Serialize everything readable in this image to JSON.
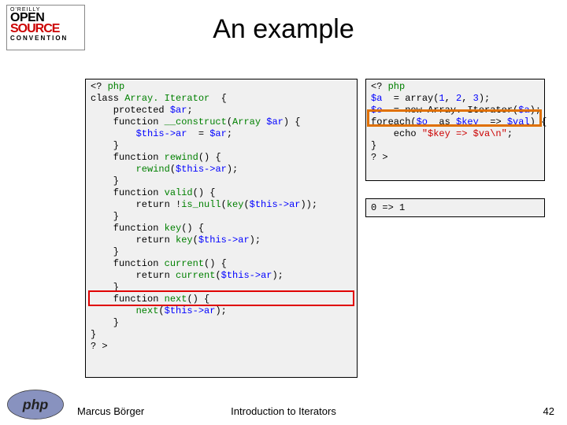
{
  "logo": {
    "oreilly": "O'REILLY",
    "open": "OPEN",
    "source": "SOURCE",
    "convention": "CONVENTION"
  },
  "title": "An example",
  "code_left": {
    "t": [
      {
        "s": [
          "<? ",
          "php"
        ]
      },
      {
        "s": [
          "class ",
          "Array. Iterator ",
          " {"
        ]
      },
      {
        "s": [
          "    protected ",
          "$ar",
          ";"
        ]
      },
      {
        "s": [
          "    function ",
          "__construct",
          "(",
          "Array ",
          "$ar",
          ") {"
        ]
      },
      {
        "s": [
          "        ",
          "$this->ar ",
          " = ",
          "$ar",
          ";"
        ]
      },
      {
        "s": [
          "    }"
        ]
      },
      {
        "s": [
          "    function ",
          "rewind",
          "() {"
        ]
      },
      {
        "s": [
          "        ",
          "rewind",
          "(",
          "$this->ar",
          ");"
        ]
      },
      {
        "s": [
          "    }"
        ]
      },
      {
        "s": [
          "    function ",
          "valid",
          "() {"
        ]
      },
      {
        "s": [
          "        return !",
          "is_null",
          "(",
          "key",
          "(",
          "$this->ar",
          "));"
        ]
      },
      {
        "s": [
          "    }"
        ]
      },
      {
        "s": [
          "    function ",
          "key",
          "() {"
        ]
      },
      {
        "s": [
          "        return ",
          "key",
          "(",
          "$this->ar",
          ");"
        ]
      },
      {
        "s": [
          "    }"
        ]
      },
      {
        "s": [
          "    function ",
          "current",
          "() {"
        ]
      },
      {
        "s": [
          "        return ",
          "current",
          "(",
          "$this->ar",
          ");"
        ]
      },
      {
        "s": [
          "    }"
        ]
      },
      {
        "s": [
          "    function ",
          "next",
          "() {"
        ]
      },
      {
        "s": [
          "        ",
          "next",
          "(",
          "$this->ar",
          ");"
        ]
      },
      {
        "s": [
          "    }"
        ]
      },
      {
        "s": [
          "}"
        ]
      },
      {
        "s": [
          "? >"
        ]
      }
    ]
  },
  "code_right": {
    "t": [
      {
        "s": [
          "<? ",
          "php"
        ]
      },
      {
        "s": [
          "$a ",
          " = array(",
          "1",
          ", ",
          "2",
          ", ",
          "3",
          ");"
        ]
      },
      {
        "s": [
          "$o ",
          " = new Array. Iterator(",
          "$a",
          ");"
        ]
      },
      {
        "s": [
          "foreach(",
          "$o ",
          " as ",
          "$key ",
          " => ",
          "$val",
          ") {"
        ]
      },
      {
        "s": [
          "    echo ",
          "\"$key => $va\\n\"",
          ";"
        ]
      },
      {
        "s": [
          "}"
        ]
      },
      {
        "s": [
          "? >"
        ]
      }
    ]
  },
  "output": "0 => 1",
  "footer": {
    "author": "Marcus Börger",
    "title": "Introduction to Iterators",
    "page": "42"
  }
}
